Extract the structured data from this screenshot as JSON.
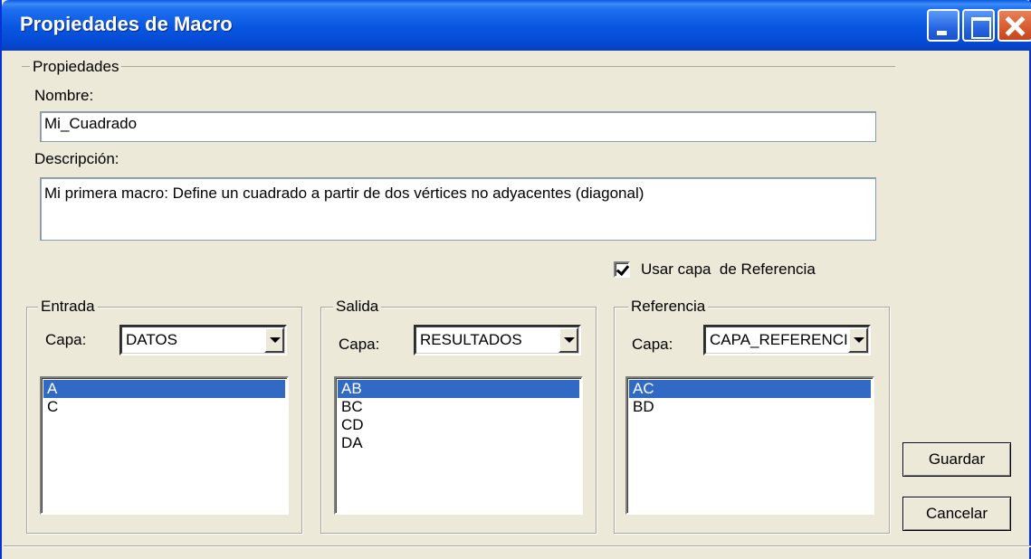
{
  "window": {
    "title": "Propiedades de Macro"
  },
  "properties": {
    "group_label": "Propiedades",
    "name_label": "Nombre:",
    "name_value": "Mi_Cuadrado",
    "description_label": "Descripción:",
    "description_value": "Mi primera macro: Define un cuadrado a partir de dos vértices no adyacentes (diagonal)"
  },
  "reference_checkbox": {
    "label": "Usar capa  de Referencia",
    "checked": true
  },
  "entrada": {
    "group_label": "Entrada",
    "layer_label": "Capa:",
    "layer_value": "DATOS",
    "items": [
      {
        "label": "A",
        "selected": true
      },
      {
        "label": "C",
        "selected": false
      }
    ]
  },
  "salida": {
    "group_label": "Salida",
    "layer_label": "Capa:",
    "layer_value": "RESULTADOS",
    "items": [
      {
        "label": "AB",
        "selected": true
      },
      {
        "label": "BC",
        "selected": false
      },
      {
        "label": "CD",
        "selected": false
      },
      {
        "label": "DA",
        "selected": false
      }
    ]
  },
  "referencia": {
    "group_label": "Referencia",
    "layer_label": "Capa:",
    "layer_value": "CAPA_REFERENCIA",
    "items": [
      {
        "label": "AC",
        "selected": true
      },
      {
        "label": "BD",
        "selected": false
      }
    ]
  },
  "buttons": {
    "save": "Guardar",
    "cancel": "Cancelar"
  }
}
